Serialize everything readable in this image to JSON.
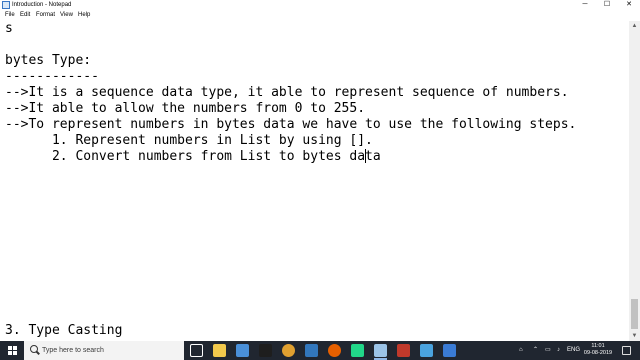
{
  "window": {
    "title": "Introduction - Notepad",
    "minimize_glyph": "─",
    "maximize_glyph": "☐",
    "close_glyph": "✕"
  },
  "menu": [
    {
      "label": "File"
    },
    {
      "label": "Edit"
    },
    {
      "label": "Format"
    },
    {
      "label": "View"
    },
    {
      "label": "Help"
    }
  ],
  "editor": {
    "lines": [
      "s",
      "",
      "bytes Type:",
      "------------",
      "-->It is a sequence data type, it able to represent sequence of numbers.",
      "-->It able to allow the numbers from 0 to 255.",
      "-->To represent numbers in bytes data we have to use the following steps.",
      "      1. Represent numbers in List by using [].",
      "      2. Convert numbers from List to bytes data"
    ],
    "bottom_line": "3. Type Casting"
  },
  "taskbar": {
    "search_placeholder": "Type here to search",
    "language": "ENG",
    "time": "11:01",
    "date": "09-08-2019",
    "pinned_icons": [
      {
        "name": "task-view-icon",
        "color": "#ffffff"
      },
      {
        "name": "file-explorer-icon",
        "color": "#f2c94c"
      },
      {
        "name": "store-icon",
        "color": "#4a90d9"
      },
      {
        "name": "terminal-icon",
        "color": "#1e1e1e"
      },
      {
        "name": "chrome-icon",
        "color": "#e0a030"
      },
      {
        "name": "edge-icon",
        "color": "#3277bc"
      },
      {
        "name": "firefox-icon",
        "color": "#e66000"
      },
      {
        "name": "pycharm-icon",
        "color": "#21d789"
      },
      {
        "name": "notepad-icon",
        "color": "#9bc4e8"
      },
      {
        "name": "record-icon",
        "color": "#c0392b"
      },
      {
        "name": "monitor-icon",
        "color": "#4aa3df"
      },
      {
        "name": "settings-app-icon",
        "color": "#3a7bd5"
      }
    ]
  }
}
